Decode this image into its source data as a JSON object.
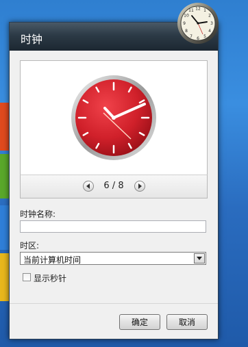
{
  "dialog": {
    "title": "时钟",
    "pager": {
      "current": "6 / 8"
    },
    "name_label": "时钟名称:",
    "name_value": "",
    "timezone_label": "时区:",
    "timezone_value": "当前计算机时间",
    "show_seconds_label": "显示秒针",
    "show_seconds_checked": false,
    "ok_label": "确定",
    "cancel_label": "取消"
  },
  "colors": {
    "clock_face": "#d0202a",
    "title_bar": "#2c3a46"
  },
  "icons": [
    "prev-arrow-icon",
    "next-arrow-icon",
    "dropdown-arrow-icon",
    "clock-gadget-icon"
  ]
}
